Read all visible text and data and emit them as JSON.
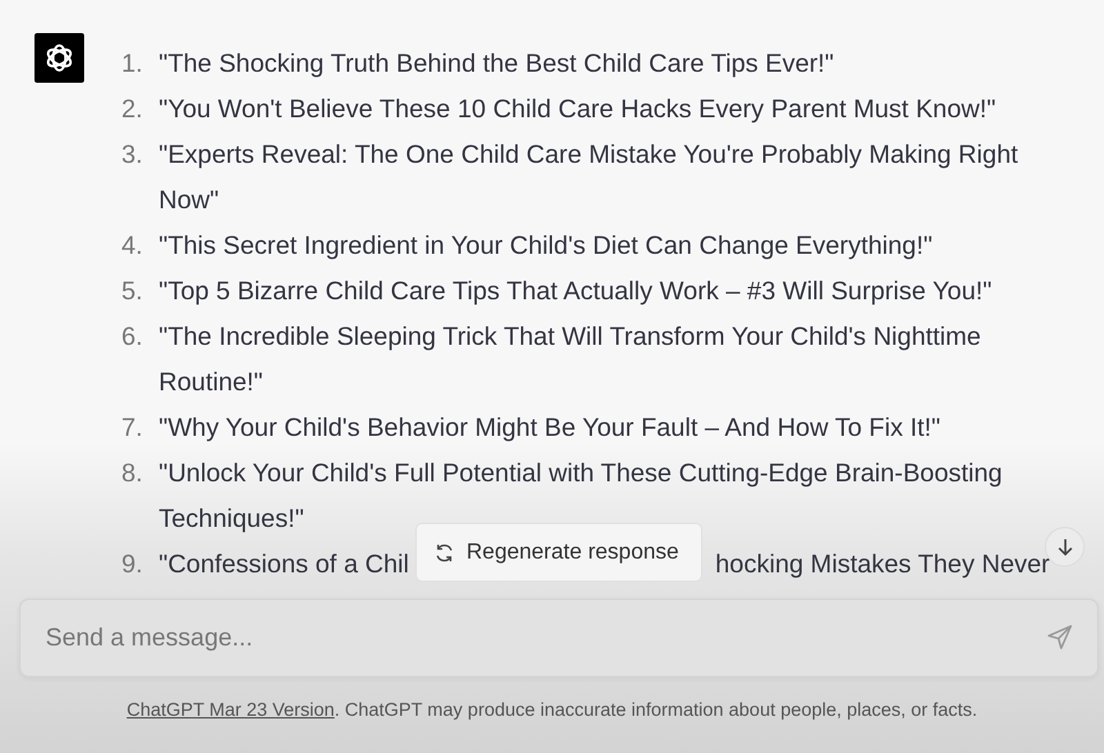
{
  "message": {
    "items": [
      {
        "number": "1.",
        "text": "\"The Shocking Truth Behind the Best Child Care Tips Ever!\""
      },
      {
        "number": "2.",
        "text": "\"You Won't Believe These 10 Child Care Hacks Every Parent Must Know!\""
      },
      {
        "number": "3.",
        "text": "\"Experts Reveal: The One Child Care Mistake You're Probably Making Right Now\""
      },
      {
        "number": "4.",
        "text": "\"This Secret Ingredient in Your Child's Diet Can Change Everything!\""
      },
      {
        "number": "5.",
        "text": "\"Top 5 Bizarre Child Care Tips That Actually Work – #3 Will Surprise You!\""
      },
      {
        "number": "6.",
        "text": "\"The Incredible Sleeping Trick That Will Transform Your Child's Nighttime Routine!\""
      },
      {
        "number": "7.",
        "text": "\"Why Your Child's Behavior Might Be Your Fault – And How To Fix It!\""
      },
      {
        "number": "8.",
        "text": "\"Unlock Your Child's Full Potential with These Cutting-Edge Brain-Boosting Techniques!\""
      }
    ],
    "last_item": {
      "number": "9.",
      "text_before": "\"Confessions of a Chil",
      "text_after": "hocking Mistakes They Never"
    }
  },
  "regenerate_button": "Regenerate response",
  "composer": {
    "placeholder": "Send a message..."
  },
  "footer": {
    "link": "ChatGPT Mar 23 Version",
    "text": ". ChatGPT may produce inaccurate information about people, places, or facts."
  }
}
